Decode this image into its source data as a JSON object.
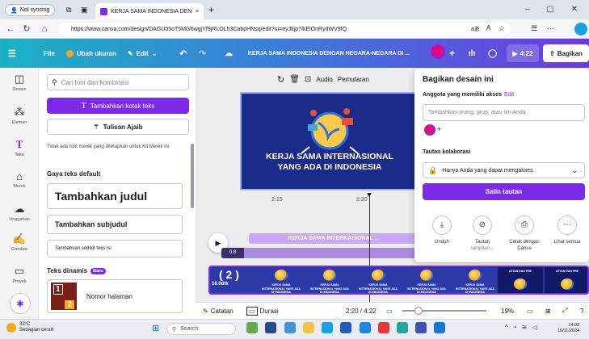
{
  "browser": {
    "profile_label": "Not syncing",
    "tab_title": "KERJA SAMA INDONESIA DENGA",
    "url": "https://www.canva.com/design/DAGU05oT5M0/6wgjYf9jRLOLh3CabpHNsq/edit?ui=eyJlIjp7IkEiOnRydWV9fQ"
  },
  "toolbar": {
    "file": "File",
    "resize": "Ubah ukuran",
    "edit": "Edit",
    "doc_title": "KERJA SAMA INDONESIA DENGAN NEGARA-NEGARA DI ...",
    "timer": "4:22",
    "share": "Bagikan"
  },
  "rail": [
    {
      "label": "Desain",
      "icon": "layout-icon"
    },
    {
      "label": "Elemen",
      "icon": "elements-icon"
    },
    {
      "label": "Teks",
      "icon": "text-icon"
    },
    {
      "label": "Merek",
      "icon": "brand-icon"
    },
    {
      "label": "Unggahan",
      "icon": "upload-icon"
    },
    {
      "label": "Gambar",
      "icon": "draw-icon"
    },
    {
      "label": "Proyek",
      "icon": "projects-icon"
    }
  ],
  "panel": {
    "search_placeholder": "Cari font dan kombinasi",
    "add_textbox": "Tambahkan kotak teks",
    "magic_write": "Tulisan Ajaib",
    "brand_note": "Tidak ada font merek yang ditetapkan untuk Kit Merek ini",
    "default_styles": "Gaya teks default",
    "add_heading": "Tambahkan judul",
    "add_subheading": "Tambahkan subjudul",
    "add_body": "Tambahkan sedikit teks isi",
    "dynamic_text": "Teks dinamis",
    "new_badge": "Baru",
    "page_number": "Nomor halaman",
    "page_box_top": "1",
    "page_box_bottom": "2"
  },
  "editor": {
    "audio": "Audio",
    "playback": "Pemutaran",
    "slide_title_line1": "KERJA SAMA INTERNASIONAL",
    "slide_title_line2": "YANG ADA DI INDONESIA",
    "ruler": [
      "2:15",
      "2:20"
    ],
    "track_label": "KERJA SAMA INTERNASIONAL ...",
    "track_mini": "0:8",
    "strip_count": "( 2 )",
    "strip_duration": "16.0dtk",
    "thumb_caption": "KERJA SAMA INTERNASIONAL YANG ADA DI INDONESIA",
    "thumb_alt_caption": "ATTAN DAN PRE"
  },
  "footer": {
    "notes": "Catatan",
    "duration": "Durasi",
    "time": "2:20 / 4:22",
    "zoom": "19%",
    "zoom_level": 0.19
  },
  "share_panel": {
    "title": "Bagikan desain ini",
    "access_label": "Anggota yang memiliki akses",
    "edit_link": "Edit",
    "invite_placeholder": "Tambahkan orang, grup, atau tim Anda",
    "collab_label": "Tautan kolaborasi",
    "access_option": "Hanya Anda yang dapat mengakses",
    "copy_link": "Salin tautan",
    "actions": [
      {
        "label": "Unduh",
        "sub": "",
        "icon": "download-icon"
      },
      {
        "label": "Tautan",
        "sub": "tampilan...",
        "icon": "link-icon"
      },
      {
        "label": "Cetak dengan",
        "sub": "Canva",
        "icon": "print-icon"
      },
      {
        "label": "Lihat semua",
        "sub": "",
        "icon": "more-icon"
      }
    ]
  },
  "taskbar": {
    "temp": "33°C",
    "weather": "Sebagian cerah",
    "search": "Search",
    "time": "14:02",
    "date": "10/11/2024"
  },
  "colors": {
    "accent": "#7d2ae8",
    "slide_bg": "#1a2b8a",
    "toolbar_gradient_start": "#1cb1c3",
    "toolbar_gradient_end": "#6c3be0"
  }
}
